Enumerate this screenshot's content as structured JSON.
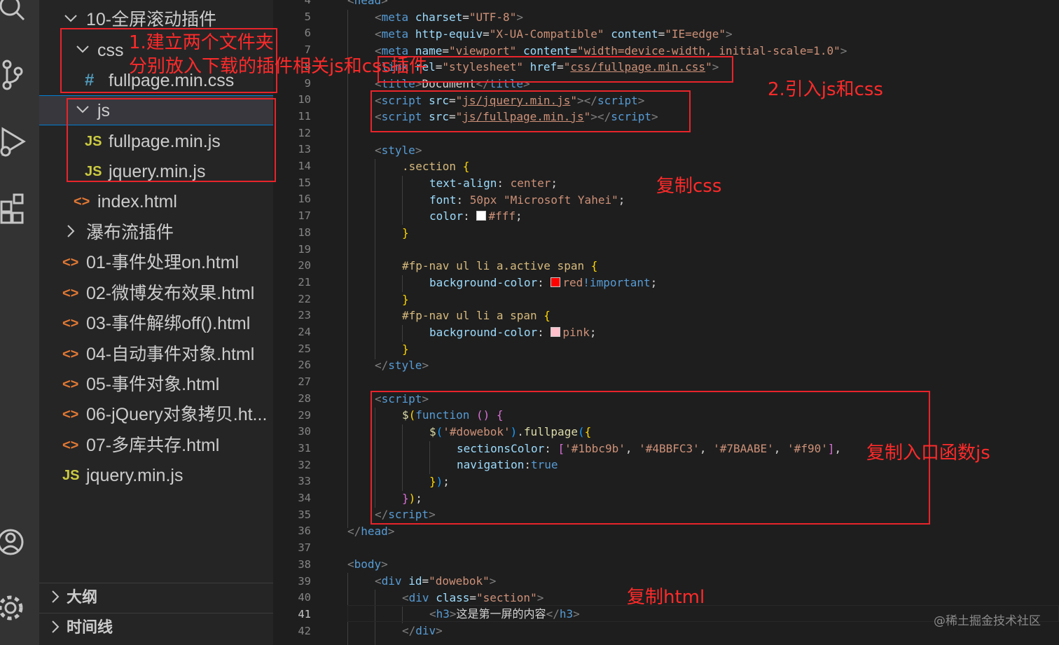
{
  "activity_bar": {
    "icons": [
      "search-icon",
      "source-control-icon",
      "run-debug-icon",
      "extensions-icon",
      "account-icon",
      "settings-gear-icon"
    ]
  },
  "explorer": {
    "items": [
      {
        "label": "10-全屏滚动插件",
        "type": "folder",
        "expanded": true
      },
      {
        "label": "css",
        "type": "folder",
        "expanded": true
      },
      {
        "label": "fullpage.min.css",
        "type": "css",
        "icon": "#"
      },
      {
        "label": "js",
        "type": "folder",
        "expanded": true,
        "selected": true
      },
      {
        "label": "fullpage.min.js",
        "type": "js",
        "icon": "JS"
      },
      {
        "label": "jquery.min.js",
        "type": "js",
        "icon": "JS"
      },
      {
        "label": "index.html",
        "type": "html",
        "icon": "<>"
      },
      {
        "label": "瀑布流插件",
        "type": "folder",
        "expanded": false
      },
      {
        "label": "01-事件处理on.html",
        "type": "html",
        "icon": "<>"
      },
      {
        "label": "02-微博发布效果.html",
        "type": "html",
        "icon": "<>"
      },
      {
        "label": "03-事件解绑off().html",
        "type": "html",
        "icon": "<>"
      },
      {
        "label": "04-自动事件对象.html",
        "type": "html",
        "icon": "<>"
      },
      {
        "label": "05-事件对象.html",
        "type": "html",
        "icon": "<>"
      },
      {
        "label": "06-jQuery对象拷贝.ht...",
        "type": "html",
        "icon": "<>"
      },
      {
        "label": "07-多库共存.html",
        "type": "html",
        "icon": "<>"
      },
      {
        "label": "jquery.min.js",
        "type": "js",
        "icon": "JS"
      }
    ],
    "panels": [
      "大纲",
      "时间线"
    ]
  },
  "editor": {
    "line_numbers": [
      "4",
      "5",
      "6",
      "7",
      "8",
      "9",
      "10",
      "11",
      "12",
      "13",
      "14",
      "15",
      "16",
      "17",
      "18",
      "19",
      "20",
      "21",
      "22",
      "23",
      "24",
      "25",
      "26",
      "27",
      "28",
      "29",
      "30",
      "31",
      "32",
      "33",
      "34",
      "35",
      "36",
      "37",
      "38",
      "39",
      "40",
      "41",
      "42"
    ],
    "active_line": "41"
  },
  "colors": {
    "white": "#ffffff",
    "red": "#ff0000",
    "pink": "#ffc0cb",
    "annotation": "#ff2a2a"
  },
  "annotations": {
    "a1_line1": "1.建立两个文件夹",
    "a1_line2": "分别放入下载的插件相关js和css插件",
    "a2": "2.引入js和css",
    "a3": "复制css",
    "a4": "复制入口函数js",
    "a5": "复制html"
  },
  "watermark": "@稀土掘金技术社区"
}
